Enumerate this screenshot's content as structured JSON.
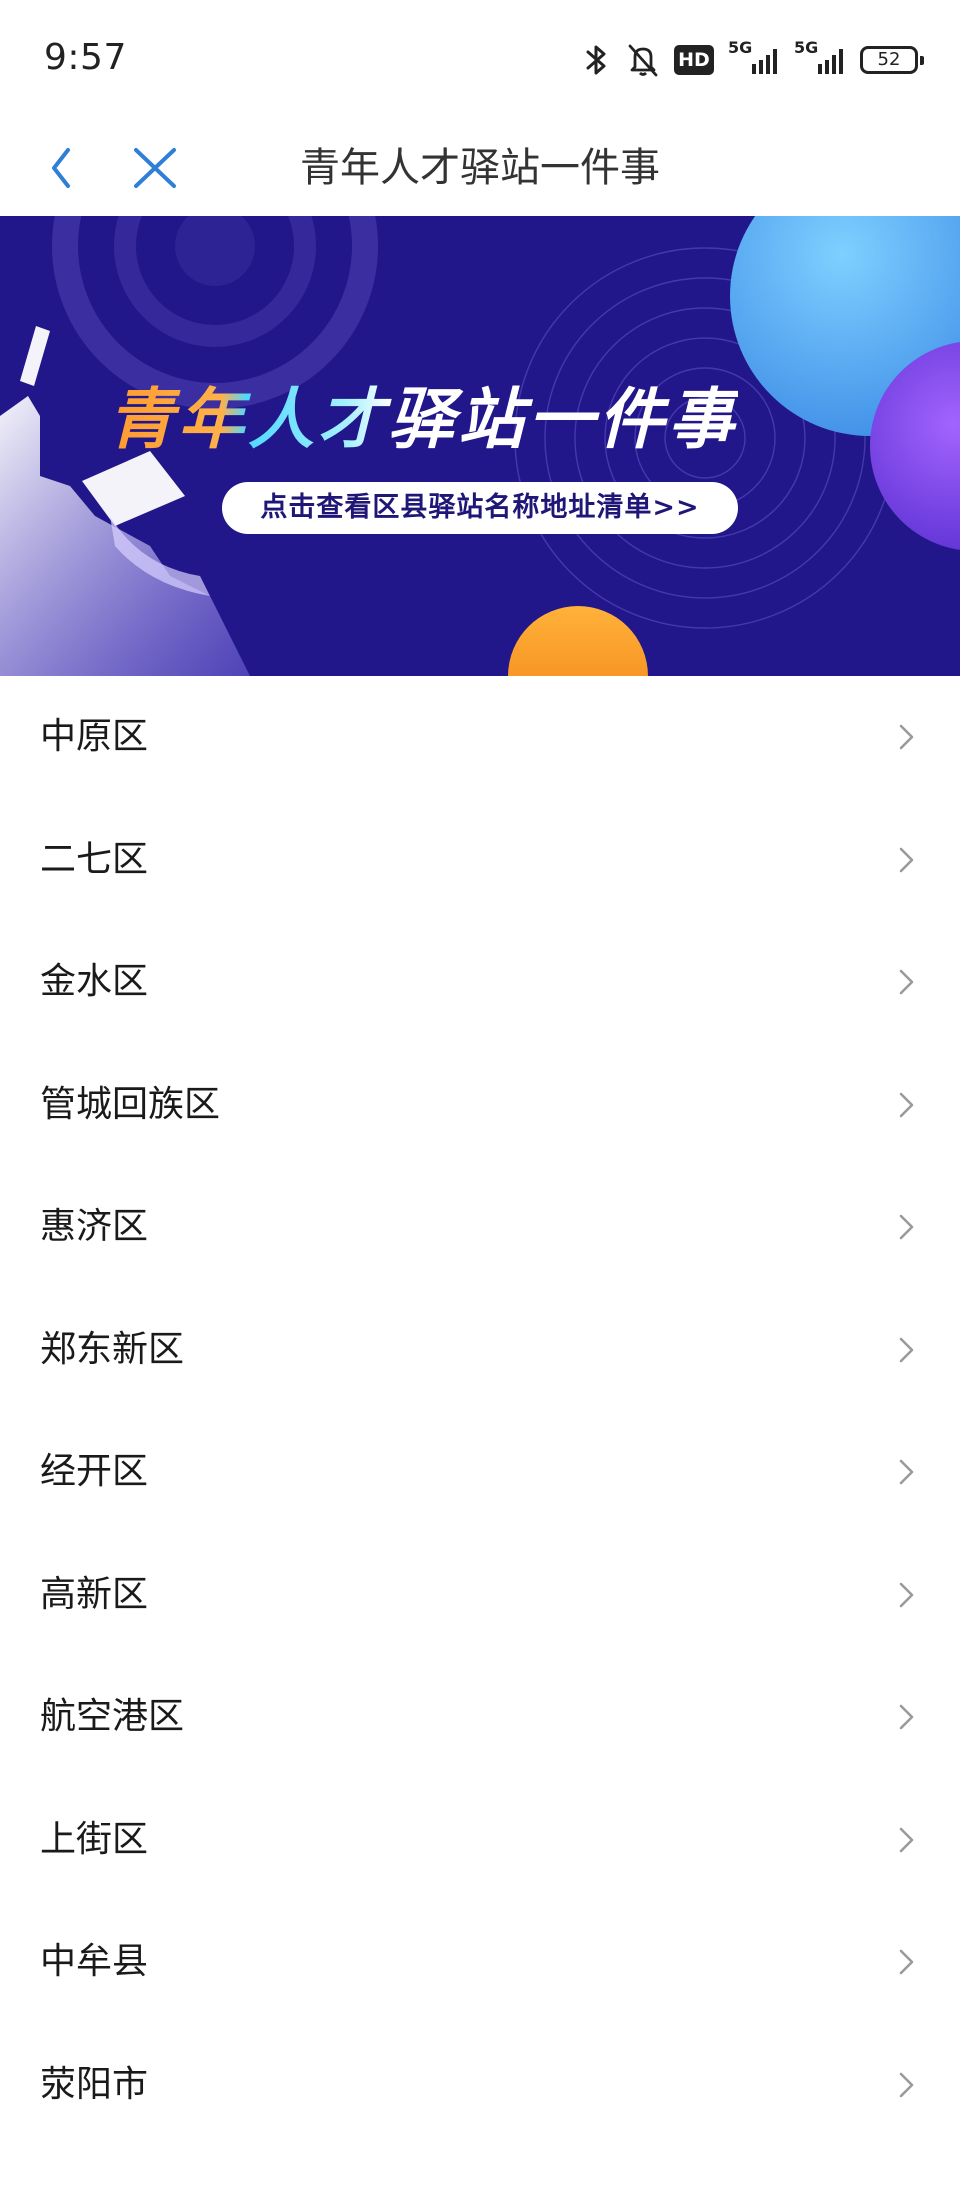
{
  "status_bar": {
    "time": "9:57",
    "hd_label": "HD",
    "sim1_label": "5G",
    "sim2_label": "5G",
    "battery_level": "52",
    "icons": [
      "bluetooth-icon",
      "bell-muted-icon",
      "hd-icon",
      "signal-icon",
      "signal-icon",
      "battery-icon"
    ]
  },
  "nav": {
    "title": "青年人才驿站一件事",
    "back_icon": "chevron-left-icon",
    "close_icon": "close-icon",
    "accent_color": "#2f7fd6"
  },
  "banner": {
    "title": "青年人才驿站一件事",
    "link_text": "点击查看区县驿站名称地址清单>>",
    "background_color": "#22178a"
  },
  "districts": [
    {
      "label": "中原区"
    },
    {
      "label": "二七区"
    },
    {
      "label": "金水区"
    },
    {
      "label": "管城回族区"
    },
    {
      "label": "惠济区"
    },
    {
      "label": "郑东新区"
    },
    {
      "label": "经开区"
    },
    {
      "label": "高新区"
    },
    {
      "label": "航空港区"
    },
    {
      "label": "上街区"
    },
    {
      "label": "中牟县"
    },
    {
      "label": "荥阳市"
    }
  ]
}
